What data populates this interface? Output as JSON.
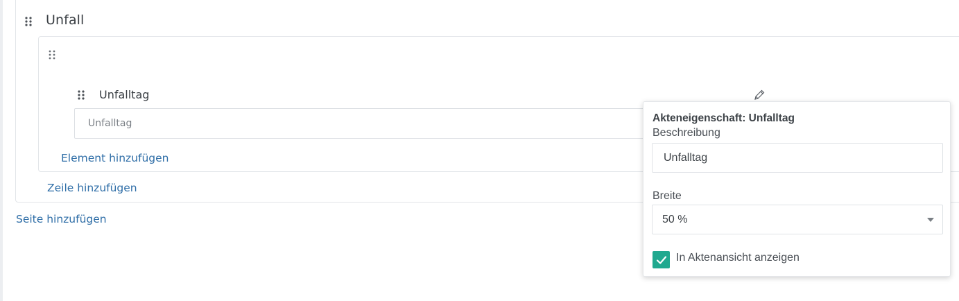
{
  "section": {
    "title": "Unfall",
    "add_row_label": "Zeile hinzufügen"
  },
  "row": {
    "add_element_label": "Element hinzufügen"
  },
  "field": {
    "label": "Unfalltag",
    "placeholder": "Unfalltag"
  },
  "page_actions": {
    "add_page_label": "Seite hinzufügen"
  },
  "popover": {
    "title": "Akteneigenschaft: Unfalltag",
    "description_label": "Beschreibung",
    "description_value": "Unfalltag",
    "width_label": "Breite",
    "width_value": "50 %",
    "show_in_view_label": "In Aktenansicht anzeigen",
    "show_in_view_checked": true
  },
  "colors": {
    "link": "#2f6ea7",
    "accent": "#20a98f",
    "border": "#e2e5e9"
  },
  "icons": [
    "drag-handle-icon",
    "pencil-icon",
    "chevron-down-icon",
    "checkmark-icon"
  ]
}
